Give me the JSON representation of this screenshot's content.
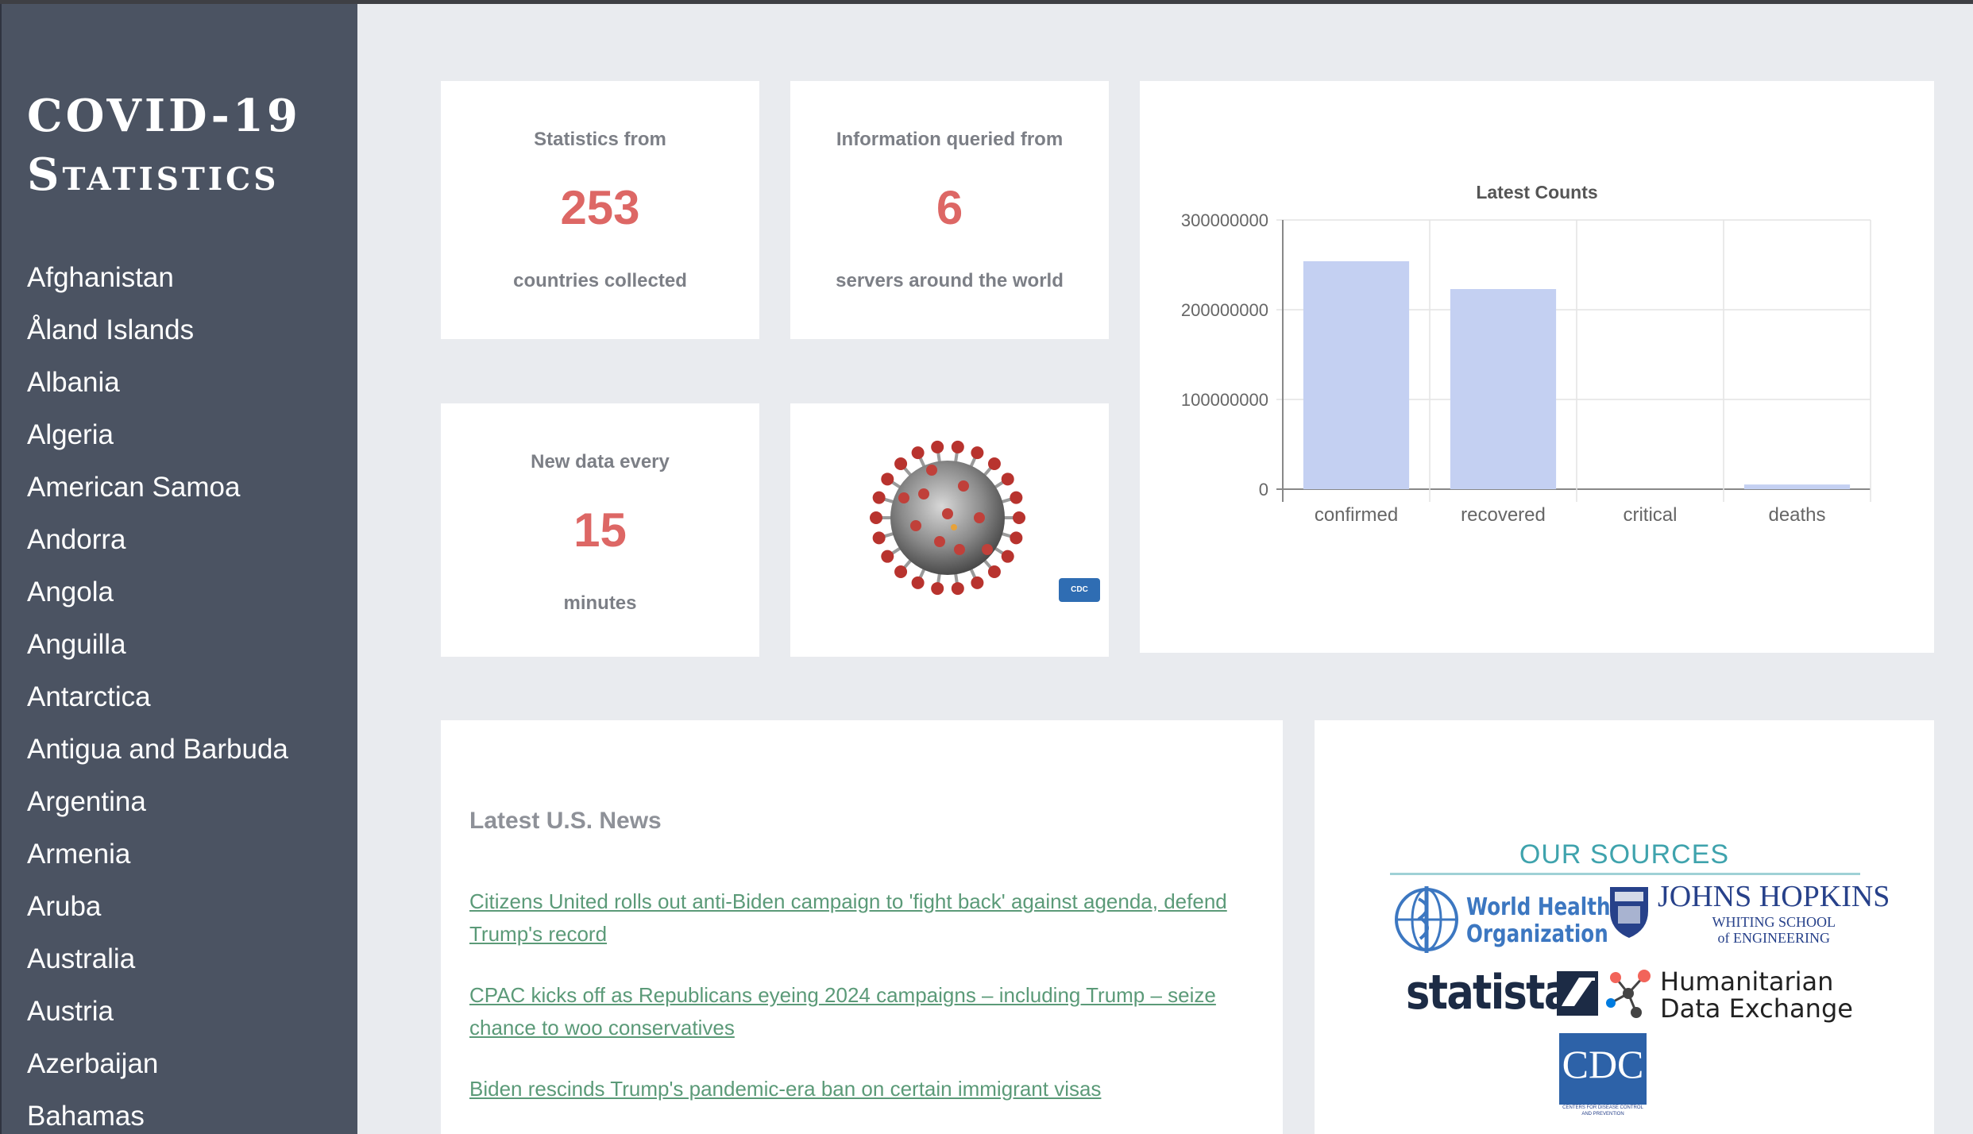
{
  "sidebar": {
    "brand_line1": "COVID-19",
    "brand_line2": "Statistics",
    "countries": [
      "Afghanistan",
      "Åland Islands",
      "Albania",
      "Algeria",
      "American Samoa",
      "Andorra",
      "Angola",
      "Anguilla",
      "Antarctica",
      "Antigua and Barbuda",
      "Argentina",
      "Armenia",
      "Aruba",
      "Australia",
      "Austria",
      "Azerbaijan",
      "Bahamas"
    ]
  },
  "stats": {
    "countries": {
      "label": "Statistics from",
      "value": "253",
      "sub": "countries collected"
    },
    "servers": {
      "label": "Information queried from",
      "value": "6",
      "sub": "servers around the world"
    },
    "refresh": {
      "label": "New data every",
      "value": "15",
      "sub": "minutes"
    }
  },
  "image_card": {
    "badge": "CDC",
    "icon": "coronavirus-icon"
  },
  "colors": {
    "accent": "#dd6765",
    "sidebar": "#4b5362",
    "bar": "#c4d0f2",
    "link": "#5b9a78",
    "sources_title": "#3fa3ad"
  },
  "chart_data": {
    "type": "bar",
    "title": "Latest Counts",
    "categories": [
      "confirmed",
      "recovered",
      "critical",
      "deaths"
    ],
    "values": [
      254000000,
      223000000,
      0,
      5200000
    ],
    "ylim": [
      0,
      300000000
    ],
    "yticks": [
      0,
      100000000,
      200000000,
      300000000
    ],
    "ytick_labels": [
      "0",
      "100000000",
      "200000000",
      "300000000"
    ],
    "xlabel": "",
    "ylabel": "",
    "grid": true,
    "legend": "none"
  },
  "news": {
    "title": "Latest U.S. News",
    "items": [
      "Citizens United rolls out anti-Biden campaign to 'fight back' against agenda, defend Trump's record",
      "CPAC kicks off as Republicans eyeing 2024 campaigns – including Trump – seize chance to woo conservatives",
      "Biden rescinds Trump's pandemic-era ban on certain immigrant visas"
    ]
  },
  "sources": {
    "title": "OUR SOURCES",
    "who_line1": "World Health",
    "who_line2": "Organization",
    "jhu_name": "JOHNS HOPKINS",
    "jhu_sub1": "WHITING SCHOOL",
    "jhu_sub2": "of ENGINEERING",
    "statista": "statista",
    "hdx_line1": "Humanitarian",
    "hdx_line2": "Data Exchange",
    "cdc": "CDC",
    "cdc_sub": "CENTERS FOR DISEASE CONTROL AND PREVENTION"
  }
}
